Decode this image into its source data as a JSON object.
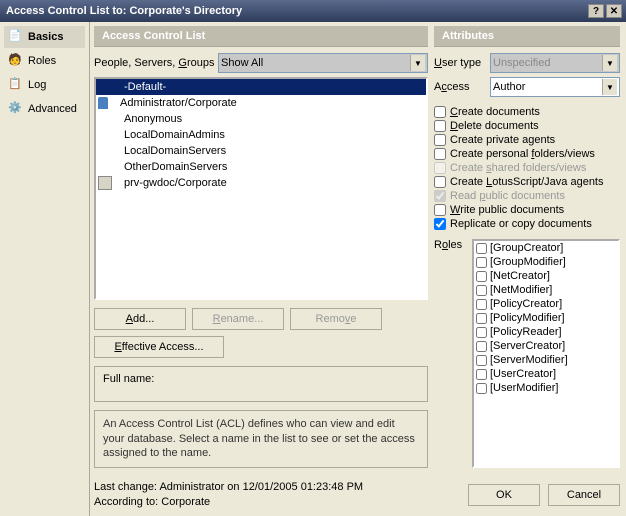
{
  "window": {
    "title": "Access Control List to: Corporate's Directory"
  },
  "sidebar": {
    "items": [
      {
        "label": "Basics",
        "active": true
      },
      {
        "label": "Roles",
        "active": false
      },
      {
        "label": "Log",
        "active": false
      },
      {
        "label": "Advanced",
        "active": false
      }
    ]
  },
  "acl_panel": {
    "header": "Access Control List",
    "filter_label": "People, Servers, Groups",
    "filter_value": "Show All",
    "entries": [
      {
        "name": "-Default-",
        "icon": "none",
        "selected": true
      },
      {
        "name": "Administrator/Corporate",
        "icon": "person",
        "selected": false
      },
      {
        "name": "Anonymous",
        "icon": "none",
        "selected": false
      },
      {
        "name": "LocalDomainAdmins",
        "icon": "group",
        "selected": false
      },
      {
        "name": "LocalDomainServers",
        "icon": "group",
        "selected": false
      },
      {
        "name": "OtherDomainServers",
        "icon": "group",
        "selected": false
      },
      {
        "name": "prv-gwdoc/Corporate",
        "icon": "server",
        "selected": false
      }
    ],
    "buttons": {
      "add": "Add...",
      "rename": "Rename...",
      "remove": "Remove"
    },
    "effective_access": "Effective Access...",
    "fullname_label": "Full name:",
    "fullname_value": "",
    "hint": "An Access Control List (ACL) defines who can view and edit your database. Select a name in the list to see or set the access assigned to the name."
  },
  "attributes": {
    "header": "Attributes",
    "user_type_label": "User type",
    "user_type_value": "Unspecified",
    "access_label": "Access",
    "access_value": "Author",
    "permissions": [
      {
        "label": "Create documents",
        "underline": "C",
        "checked": false,
        "disabled": false
      },
      {
        "label": "Delete documents",
        "underline": "D",
        "checked": false,
        "disabled": false
      },
      {
        "label": "Create private agents",
        "underline": "",
        "checked": false,
        "disabled": false
      },
      {
        "label": "Create personal folders/views",
        "underline": "f",
        "checked": false,
        "disabled": false
      },
      {
        "label": "Create shared folders/views",
        "underline": "s",
        "checked": false,
        "disabled": true
      },
      {
        "label": "Create LotusScript/Java agents",
        "underline": "L",
        "checked": false,
        "disabled": false
      },
      {
        "label": "Read public documents",
        "underline": "p",
        "checked": true,
        "disabled": true
      },
      {
        "label": "Write public documents",
        "underline": "W",
        "checked": false,
        "disabled": false
      },
      {
        "label": "Replicate or copy documents",
        "underline": "",
        "checked": true,
        "disabled": false
      }
    ],
    "roles_label": "Roles",
    "roles": [
      "[GroupCreator]",
      "[GroupModifier]",
      "[NetCreator]",
      "[NetModifier]",
      "[PolicyCreator]",
      "[PolicyModifier]",
      "[PolicyReader]",
      "[ServerCreator]",
      "[ServerModifier]",
      "[UserCreator]",
      "[UserModifier]"
    ]
  },
  "footer": {
    "line1": "Last change: Administrator on 12/01/2005 01:23:48 PM",
    "line2": "According to: Corporate",
    "ok": "OK",
    "cancel": "Cancel"
  }
}
